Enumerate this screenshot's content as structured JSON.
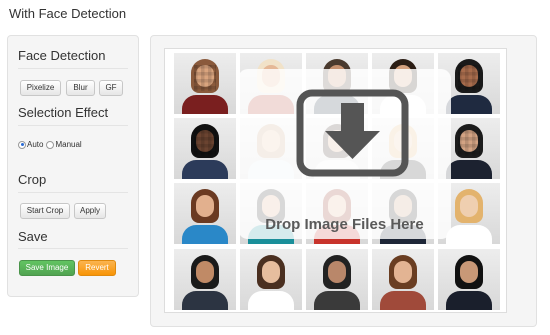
{
  "header": {
    "title": "With Face Detection"
  },
  "sidebar": {
    "face_detection": {
      "title": "Face Detection",
      "buttons": [
        "Pixelize",
        "Blur",
        "GF"
      ]
    },
    "selection_effect": {
      "title": "Selection Effect",
      "options": [
        "Auto",
        "Manual"
      ],
      "selected": "Auto"
    },
    "crop": {
      "title": "Crop",
      "buttons": [
        "Start Crop",
        "Apply"
      ]
    },
    "save": {
      "title": "Save",
      "save_label": "Save Image",
      "revert_label": "Revert"
    }
  },
  "canvas": {
    "drop_text": "Drop Image Files Here",
    "drop_icon": "download-tray-icon"
  },
  "colors": {
    "save_button": "#5bb75b",
    "revert_button": "#f89406",
    "drop_icon": "#555555",
    "radio_selected": "#2a6bd5"
  }
}
